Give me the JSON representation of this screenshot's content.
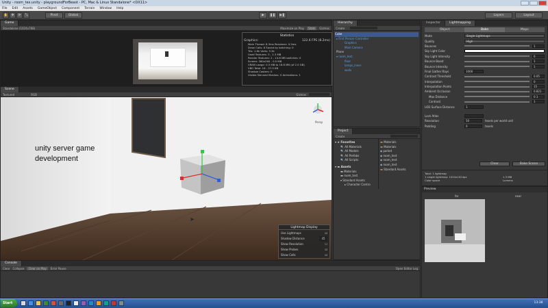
{
  "window": {
    "title": "Unity - room_tex.unity - playgroundForBeast - PC, Mac & Linux Standalone* <DX11>"
  },
  "menu": [
    "File",
    "Edit",
    "Assets",
    "GameObject",
    "Component",
    "Terrain",
    "Window",
    "Help"
  ],
  "toolbar": {
    "pivot": "Pivot",
    "global": "Global",
    "layers": "Layers",
    "layout": "Layout"
  },
  "game": {
    "tab": "Game",
    "resolution": "Standalone (1024x768)",
    "maximize": "Maximize on Play",
    "stats": "Stats",
    "gizmos": "Gizmos",
    "stats_title": "Statistics",
    "graphics_label": "Graphics:",
    "fps": "122.6 FPS (8.2ms)",
    "stats_lines": [
      "Main Thread: 8.3ms  Renderer: 0.5ms",
      "Draw Calls: 8   Saved by batching: 0",
      "Tris: 1.6k   Verts: 3.3k",
      "Used Textures: 3 - 1.3 MB",
      "Render Textures: 2 - 14.6 MB  switches: 0",
      "Screen: 360x260 - 0.5 MB",
      "VRAM usage: 0.5 MB to 16.6 MB (of 2.0 GB)",
      "VBO Total: 16 - 37.0 KB",
      "Shadow Casters: 0",
      "Visible Skinned Meshes: 0    Animations: 1"
    ]
  },
  "scene": {
    "tab": "Scene",
    "mode": "Textured",
    "rgb": "RGB",
    "gizmos": "Gizmos",
    "overlay_text": "unity server game development",
    "persp": "Persp"
  },
  "lightmap_display": {
    "title": "Lightmap Display",
    "options": [
      "Use Lightmaps",
      "Shadow Distance",
      "Show Resolution",
      "Show Probes",
      "Show Cells"
    ],
    "shadow_value": "45"
  },
  "hierarchy": {
    "tab": "Hierarchy",
    "create": "Create",
    "items": [
      "Cube",
      "First Person Controller",
      "Graphics",
      "Main Camera",
      "Plane",
      "room_test",
      "floor",
      "lamps_inner",
      "walls"
    ]
  },
  "project": {
    "tab": "Project",
    "create": "Create",
    "favorites": "Favorites",
    "fav_items": [
      "All Materials",
      "All Models",
      "All Prefabs",
      "All Scripts"
    ],
    "assets": "Assets",
    "asset_tree": [
      "Materials",
      "room_test",
      "Standard Assets",
      "Character Contro"
    ],
    "files": [
      "Materials",
      "Materials",
      "parket",
      "room_test",
      "room_test",
      "room_test",
      "Standard Assets"
    ]
  },
  "inspector": {
    "tab": "Inspector",
    "tab2": "Lightmapping",
    "subtabs": [
      "Object",
      "Bake",
      "Maps"
    ],
    "rows": [
      {
        "label": "Mode",
        "value": "Single Lightmaps"
      },
      {
        "label": "Quality",
        "value": "High"
      },
      {
        "label": "Bounces",
        "value": "1"
      },
      {
        "label": "Sky Light Color",
        "value": ""
      },
      {
        "label": "Sky Light Intensity",
        "value": "0"
      },
      {
        "label": "Bounce Boost",
        "value": "1"
      },
      {
        "label": "Bounce Intensity",
        "value": "1"
      },
      {
        "label": "Final Gather Rays",
        "value": "1000"
      },
      {
        "label": "Contrast Threshold",
        "value": "0.05"
      },
      {
        "label": "Interpolation",
        "value": "0"
      },
      {
        "label": "Interpolation Points",
        "value": "15"
      },
      {
        "label": "Ambient Occlusion",
        "value": "0.821"
      },
      {
        "label": "Max Distance",
        "value": "0.1"
      },
      {
        "label": "Contrast",
        "value": "1"
      },
      {
        "label": "LOD Surface Distance",
        "value": "1"
      }
    ],
    "rows2": [
      {
        "label": "Lock Atlas",
        "value": ""
      },
      {
        "label": "Resolution",
        "value": "50",
        "unit": "texels per world unit"
      },
      {
        "label": "Padding",
        "value": "0",
        "unit": "texels"
      }
    ],
    "clear": "Clear",
    "bake": "Bake Scene",
    "lightmap_info": [
      "Total: 1 lightmap",
      "1 single lightmap: 1024x1024px",
      "Color space"
    ],
    "info_right": [
      "1.3 MB",
      "Lumens"
    ],
    "preview": "Preview",
    "preview_labels": [
      "far",
      "near"
    ]
  },
  "console": {
    "tab": "Console",
    "buttons": [
      "Clear",
      "Collapse",
      "Clear on Play",
      "Error Pause"
    ],
    "right": "Open Editor Log"
  },
  "taskbar": {
    "start": "Start",
    "clock": "13:38"
  }
}
